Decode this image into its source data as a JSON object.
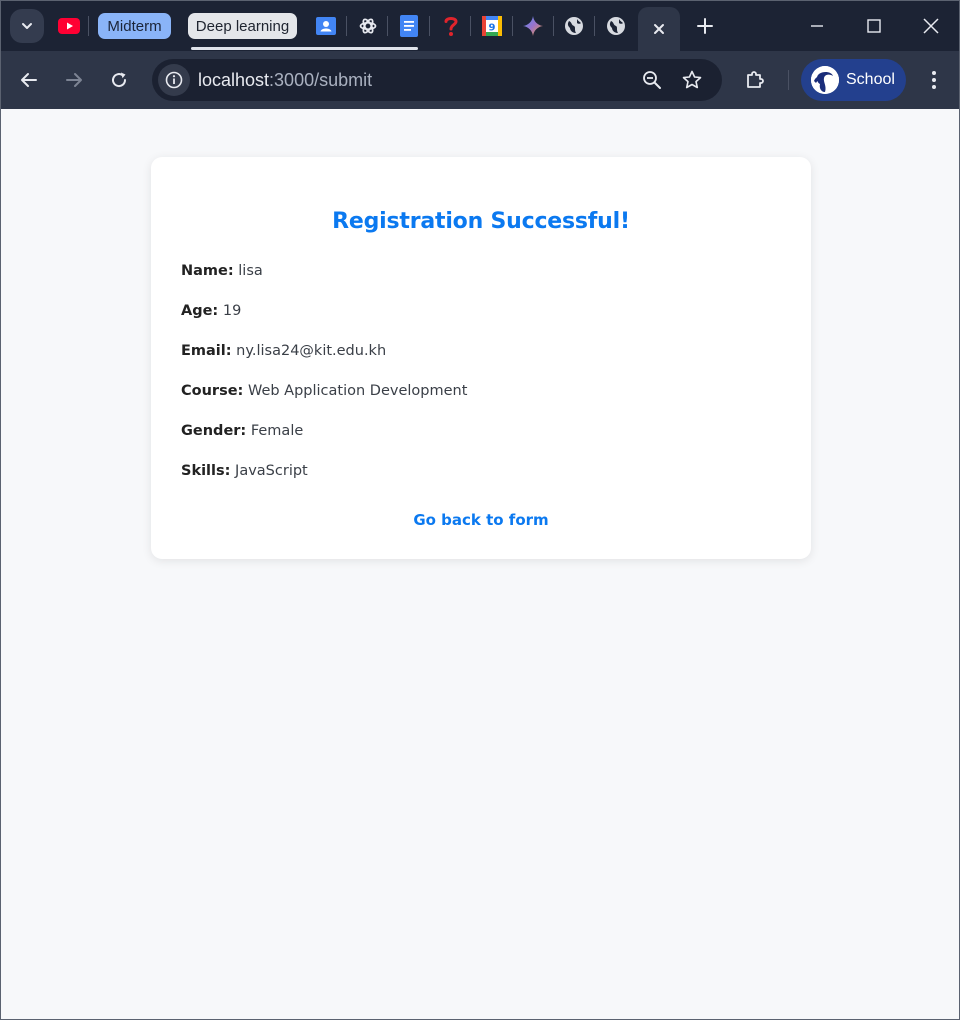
{
  "browser": {
    "tab_groups": [
      {
        "label": "Midterm"
      },
      {
        "label": "Deep learning"
      }
    ],
    "address": {
      "host": "localhost",
      "path": ":3000/submit"
    },
    "profile": {
      "label": "School"
    },
    "colors": {
      "group_midterm": "#8ab4f8",
      "group_deep": "#e4e6ea",
      "profile_bg": "#23408e",
      "accent": "#0b79f0"
    }
  },
  "page": {
    "title": "Registration Successful!",
    "fields": [
      {
        "label": "Name:",
        "value": " lisa"
      },
      {
        "label": "Age:",
        "value": " 19"
      },
      {
        "label": "Email:",
        "value": " ny.lisa24@kit.edu.kh"
      },
      {
        "label": "Course:",
        "value": " Web Application Development"
      },
      {
        "label": "Gender:",
        "value": " Female"
      },
      {
        "label": "Skills:",
        "value": " JavaScript"
      }
    ],
    "back_link": "Go back to form"
  }
}
